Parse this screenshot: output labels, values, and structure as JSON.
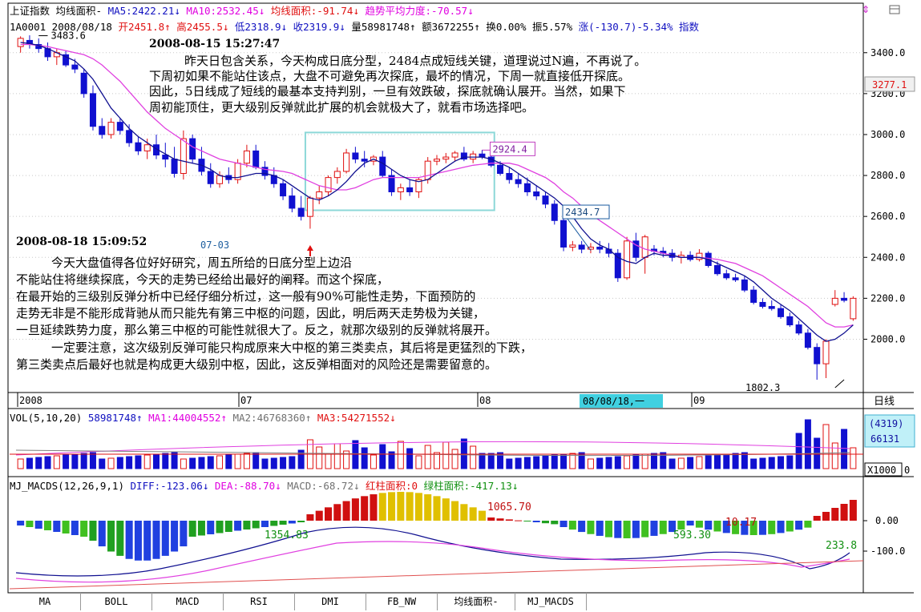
{
  "header": {
    "row1": [
      {
        "text": "上证指数 均线面积-",
        "c": "blk"
      },
      {
        "text": "MA5:2422.21↓",
        "c": "blu"
      },
      {
        "text": "MA10:2532.45↓",
        "c": "mag"
      },
      {
        "text": "均线面积:-91.74↓",
        "c": "red"
      },
      {
        "text": "趋势平均力度:-70.57↓",
        "c": "mag"
      }
    ],
    "row2": [
      {
        "text": "1A0001 2008/08/18",
        "c": "blk"
      },
      {
        "text": "开2451.8↑",
        "c": "red"
      },
      {
        "text": "高2455.5↓",
        "c": "red"
      },
      {
        "text": "低2318.9↓",
        "c": "blu"
      },
      {
        "text": "收2319.9↓",
        "c": "blu"
      },
      {
        "text": "量58981748↑",
        "c": "blk"
      },
      {
        "text": "额3672255↑",
        "c": "blk"
      },
      {
        "text": "换0.00%",
        "c": "blk"
      },
      {
        "text": "振5.57%",
        "c": "blk"
      },
      {
        "text": "涨(-130.7)-5.34%",
        "c": "blu"
      },
      {
        "text": "指数",
        "c": "blu"
      }
    ]
  },
  "notes": {
    "note1_time": "2008-08-15 15:27:47",
    "note1_lines": [
      "昨天日包含关系，今天构成日底分型，2484点成短线关键，道理说过N遍，不再说了。",
      "下周初如果不能站住该点，大盘不可避免再次探底，最坏的情况，下周一就直接低开探底。",
      "因此，5日线成了短线的最基本支持判别，一旦有效跌破，探底就确认展开。当然，如果下",
      "周初能顶住，更大级别反弹就此扩展的机会就极大了，就看市场选择吧。"
    ],
    "note2_time": "2008-08-18 15:09:52",
    "note2_lines": [
      "今天大盘值得各位好好研究，周五所给的日底分型上边沿",
      "不能站住将继续探底，今天的走势已经给出最好的阐释。而这个探底，",
      "在最开始的三级别反弹分析中已经仔细分析过，这一般有90%可能性走势，下面预防的",
      "走势无非是不能形成背驰从而只能先有第三中枢的问题，因此，明后两天走势极为关键，",
      "一旦延续跌势力度，那么第三中枢的可能性就很大了。反之，就那次级别的反弹就将展开。",
      "一定要注意，这次级别反弹可能只构成原来大中枢的第三类卖点，其后将是更猛烈的下跌，",
      "第三类卖点后最好也就是构成更大级别中枢，因此，这反弹相面对的风险还是需要留意的。"
    ]
  },
  "labels": {
    "high": "3483.6",
    "date_0703": "07-03",
    "box_high": "2924.4",
    "low_box": "2434.7",
    "low_end": "1802.3",
    "price_badge": "3277.1",
    "date_axis": [
      "2008",
      "07",
      "08",
      "09"
    ],
    "cursor_date": "08/08/18,一",
    "period": "日线"
  },
  "vol_header": [
    {
      "text": "VOL(5,10,20)",
      "c": "blk"
    },
    {
      "text": "58981748↑",
      "c": "blu"
    },
    {
      "text": "MA1:44004552↑",
      "c": "mag"
    },
    {
      "text": "MA2:46768360↑",
      "c": "gry"
    },
    {
      "text": "MA3:54271552↓",
      "c": "red"
    }
  ],
  "vol_axis": {
    "v1": "(4319)",
    "v2": "66131",
    "unit": "X1000",
    "zero": "0"
  },
  "macd_header": [
    {
      "text": "MJ_MACDS(12,26,9,1)",
      "c": "blk"
    },
    {
      "text": "DIFF:-123.06↓",
      "c": "blu"
    },
    {
      "text": "DEA:-88.70↓",
      "c": "mag"
    },
    {
      "text": "MACD:-68.72↓",
      "c": "gry"
    },
    {
      "text": "红柱面积:0",
      "c": "red"
    },
    {
      "text": "绿柱面积:-417.13↓",
      "c": "grn"
    }
  ],
  "macd_labels": {
    "a": "1065.70",
    "b": "1354.83",
    "c": "593.30",
    "d": "10.17",
    "e": "233.8"
  },
  "macd_axis": [
    "0.00",
    "-100.0"
  ],
  "tabs": [
    "MA",
    "BOLL",
    "MACD",
    "RSI",
    "DMI",
    "FB_NW",
    "均线面积-",
    "MJ_MACDS"
  ],
  "chart_data": {
    "type": "candlestick",
    "title": "上证指数",
    "y_ticks": [
      3400,
      3200,
      3000,
      2800,
      2600,
      2400,
      2200,
      2000
    ],
    "ylim": [
      1720,
      3540
    ],
    "candles": [
      [
        3430,
        3480,
        3400,
        3470
      ],
      [
        3460,
        3485,
        3420,
        3440
      ],
      [
        3440,
        3470,
        3400,
        3420
      ],
      [
        3420,
        3450,
        3360,
        3380
      ],
      [
        3380,
        3420,
        3340,
        3400
      ],
      [
        3390,
        3410,
        3330,
        3340
      ],
      [
        3340,
        3370,
        3300,
        3320
      ],
      [
        3300,
        3320,
        3180,
        3200
      ],
      [
        3200,
        3240,
        3020,
        3040
      ],
      [
        3040,
        3080,
        2980,
        3000
      ],
      [
        3000,
        3080,
        2980,
        3060
      ],
      [
        3060,
        3080,
        3000,
        3020
      ],
      [
        3020,
        3050,
        2940,
        2960
      ],
      [
        2960,
        2990,
        2900,
        2920
      ],
      [
        2920,
        2980,
        2880,
        2950
      ],
      [
        2950,
        3000,
        2880,
        2900
      ],
      [
        2900,
        2960,
        2840,
        2880
      ],
      [
        2880,
        2940,
        2790,
        2810
      ],
      [
        2810,
        3020,
        2780,
        2980
      ],
      [
        2980,
        3000,
        2860,
        2880
      ],
      [
        2880,
        2940,
        2800,
        2820
      ],
      [
        2820,
        2860,
        2740,
        2760
      ],
      [
        2760,
        2820,
        2740,
        2800
      ],
      [
        2800,
        2840,
        2760,
        2780
      ],
      [
        2780,
        2880,
        2760,
        2860
      ],
      [
        2860,
        2950,
        2840,
        2920
      ],
      [
        2920,
        2950,
        2830,
        2840
      ],
      [
        2840,
        2870,
        2780,
        2800
      ],
      [
        2800,
        2840,
        2740,
        2760
      ],
      [
        2760,
        2780,
        2680,
        2700
      ],
      [
        2700,
        2740,
        2620,
        2640
      ],
      [
        2640,
        2700,
        2580,
        2600
      ],
      [
        2600,
        2700,
        2540,
        2690
      ],
      [
        2690,
        2750,
        2660,
        2720
      ],
      [
        2720,
        2800,
        2700,
        2790
      ],
      [
        2790,
        2840,
        2760,
        2820
      ],
      [
        2820,
        2930,
        2810,
        2910
      ],
      [
        2910,
        2940,
        2860,
        2880
      ],
      [
        2880,
        2920,
        2840,
        2870
      ],
      [
        2870,
        2900,
        2850,
        2890
      ],
      [
        2890,
        2920,
        2790,
        2800
      ],
      [
        2800,
        2830,
        2700,
        2720
      ],
      [
        2720,
        2760,
        2680,
        2740
      ],
      [
        2740,
        2780,
        2700,
        2720
      ],
      [
        2720,
        2790,
        2690,
        2780
      ],
      [
        2780,
        2890,
        2760,
        2870
      ],
      [
        2870,
        2900,
        2850,
        2880
      ],
      [
        2880,
        2910,
        2860,
        2890
      ],
      [
        2890,
        2920,
        2870,
        2910
      ],
      [
        2910,
        2940,
        2870,
        2880
      ],
      [
        2880,
        2920,
        2860,
        2905
      ],
      [
        2905,
        2925,
        2880,
        2890
      ],
      [
        2890,
        2910,
        2840,
        2850
      ],
      [
        2850,
        2870,
        2800,
        2810
      ],
      [
        2810,
        2840,
        2760,
        2780
      ],
      [
        2780,
        2810,
        2740,
        2760
      ],
      [
        2760,
        2790,
        2700,
        2720
      ],
      [
        2720,
        2750,
        2680,
        2700
      ],
      [
        2700,
        2720,
        2640,
        2660
      ],
      [
        2660,
        2680,
        2560,
        2580
      ],
      [
        2580,
        2600,
        2430,
        2450
      ],
      [
        2450,
        2480,
        2430,
        2460
      ],
      [
        2460,
        2480,
        2420,
        2440
      ],
      [
        2440,
        2470,
        2420,
        2450
      ],
      [
        2450,
        2480,
        2420,
        2440
      ],
      [
        2440,
        2470,
        2400,
        2420
      ],
      [
        2420,
        2440,
        2280,
        2300
      ],
      [
        2300,
        2500,
        2290,
        2480
      ],
      [
        2480,
        2520,
        2380,
        2400
      ],
      [
        2400,
        2510,
        2320,
        2500
      ],
      [
        2440,
        2460,
        2410,
        2430
      ],
      [
        2430,
        2450,
        2400,
        2420
      ],
      [
        2420,
        2440,
        2380,
        2400
      ],
      [
        2400,
        2430,
        2370,
        2410
      ],
      [
        2410,
        2430,
        2380,
        2390
      ],
      [
        2390,
        2440,
        2380,
        2420
      ],
      [
        2420,
        2430,
        2350,
        2360
      ],
      [
        2360,
        2380,
        2310,
        2320
      ],
      [
        2320,
        2340,
        2290,
        2300
      ],
      [
        2300,
        2320,
        2280,
        2290
      ],
      [
        2290,
        2310,
        2230,
        2240
      ],
      [
        2240,
        2260,
        2170,
        2180
      ],
      [
        2180,
        2200,
        2150,
        2160
      ],
      [
        2160,
        2190,
        2140,
        2150
      ],
      [
        2150,
        2170,
        2100,
        2110
      ],
      [
        2110,
        2130,
        2060,
        2070
      ],
      [
        2070,
        2090,
        2020,
        2030
      ],
      [
        2030,
        2050,
        1950,
        1960
      ],
      [
        1960,
        1980,
        1802,
        1880
      ],
      [
        1880,
        2000,
        1810,
        1990
      ],
      [
        2170,
        2240,
        2160,
        2200
      ],
      [
        2200,
        2230,
        2180,
        2190
      ],
      [
        2100,
        2210,
        2090,
        2200
      ]
    ],
    "ma5": [
      3450,
      3445,
      3435,
      3420,
      3400,
      3380,
      3360,
      3320,
      3270,
      3200,
      3130,
      3080,
      3030,
      2990,
      2960,
      2930,
      2905,
      2880,
      2870,
      2860,
      2850,
      2830,
      2800,
      2790,
      2790,
      2800,
      2810,
      2810,
      2800,
      2780,
      2750,
      2720,
      2690,
      2680,
      2700,
      2730,
      2770,
      2820,
      2860,
      2880,
      2860,
      2830,
      2800,
      2780,
      2770,
      2780,
      2810,
      2840,
      2870,
      2890,
      2890,
      2890,
      2880,
      2860,
      2840,
      2810,
      2780,
      2750,
      2720,
      2690,
      2650,
      2600,
      2540,
      2490,
      2460,
      2440,
      2400,
      2380,
      2370,
      2400,
      2420,
      2410,
      2410,
      2400,
      2400,
      2400,
      2390,
      2370,
      2350,
      2330,
      2310,
      2280,
      2240,
      2200,
      2170,
      2140,
      2100,
      2060,
      2020,
      1990,
      2000,
      2030,
      2070
    ],
    "ma10": [
      3440,
      3440,
      3435,
      3430,
      3420,
      3410,
      3400,
      3390,
      3370,
      3340,
      3300,
      3260,
      3210,
      3160,
      3110,
      3070,
      3030,
      3000,
      2970,
      2940,
      2920,
      2900,
      2880,
      2870,
      2860,
      2850,
      2840,
      2830,
      2825,
      2820,
      2810,
      2790,
      2770,
      2750,
      2740,
      2730,
      2730,
      2740,
      2760,
      2780,
      2790,
      2790,
      2790,
      2790,
      2790,
      2800,
      2810,
      2820,
      2830,
      2840,
      2850,
      2855,
      2860,
      2860,
      2860,
      2850,
      2830,
      2810,
      2790,
      2760,
      2720,
      2690,
      2650,
      2610,
      2580,
      2550,
      2520,
      2490,
      2460,
      2440,
      2430,
      2420,
      2410,
      2400,
      2400,
      2400,
      2395,
      2390,
      2380,
      2370,
      2350,
      2330,
      2310,
      2280,
      2250,
      2220,
      2190,
      2160,
      2120,
      2080,
      2060,
      2060,
      2070
    ]
  }
}
